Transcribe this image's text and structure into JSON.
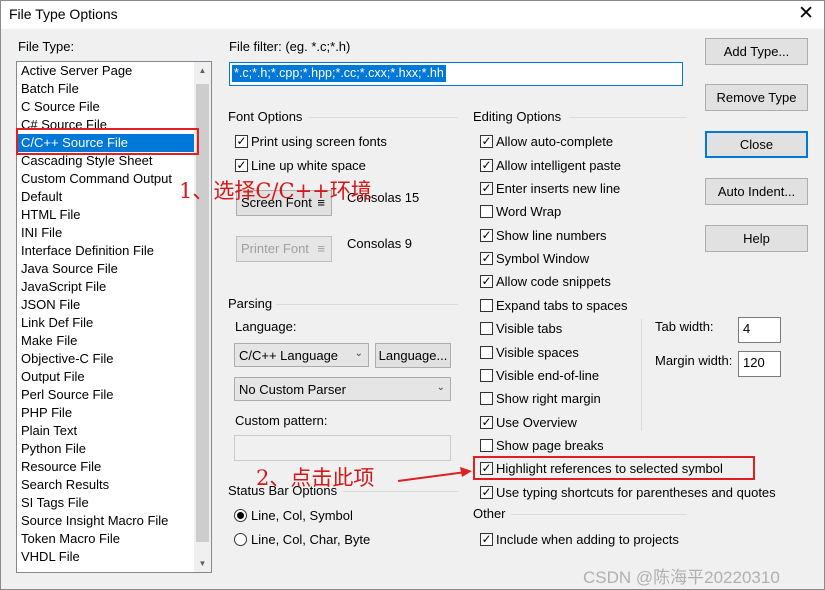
{
  "window": {
    "title": "File Type Options",
    "close_glyph": "✕"
  },
  "file_type": {
    "label": "File Type:",
    "items": [
      "Active Server Page",
      "Batch File",
      "C Source File",
      "C# Source File",
      "C/C++ Source File",
      "Cascading Style Sheet",
      "Custom Command Output",
      "Default",
      "HTML File",
      "INI File",
      "Interface Definition File",
      "Java Source File",
      "JavaScript File",
      "JSON File",
      "Link Def File",
      "Make File",
      "Objective-C File",
      "Output File",
      "Perl Source File",
      "PHP File",
      "Plain Text",
      "Python File",
      "Resource File",
      "Search Results",
      "SI Tags File",
      "Source Insight Macro File",
      "Token Macro File",
      "VHDL File"
    ],
    "selected": "C/C++ Source File"
  },
  "file_filter": {
    "label": "File filter: (eg. *.c;*.h)",
    "value": "*.c;*.h;*.cpp;*.hpp;*.cc;*.cxx;*.hxx;*.hh"
  },
  "font_options": {
    "label": "Font Options",
    "print_screen_fonts": {
      "label": "Print using screen fonts",
      "checked": true,
      "mark": "✓"
    },
    "line_up_white_space": {
      "label": "Line up white space",
      "checked": true,
      "mark": "✓"
    },
    "screen_font_button": "Screen Font",
    "screen_font_value": "Consolas 15",
    "printer_font_button": "Printer Font",
    "printer_font_value": "Consolas 9",
    "menu_glyph": "≡"
  },
  "parsing": {
    "label": "Parsing",
    "language_label": "Language:",
    "language_value": "C/C++ Language",
    "language_button": "Language...",
    "parser_value": "No Custom Parser",
    "custom_pattern_label": "Custom pattern:",
    "custom_pattern_value": "",
    "chevron": "⌄"
  },
  "status_bar": {
    "label": "Status Bar Options",
    "options": [
      {
        "label": "Line, Col, Symbol",
        "selected": true
      },
      {
        "label": "Line, Col, Char, Byte",
        "selected": false
      }
    ]
  },
  "editing": {
    "label": "Editing Options",
    "options": [
      {
        "label": "Allow auto-complete",
        "checked": true
      },
      {
        "label": "Allow intelligent paste",
        "checked": true
      },
      {
        "label": "Enter inserts new line",
        "checked": true
      },
      {
        "label": "Word Wrap",
        "checked": false
      },
      {
        "label": "Show line numbers",
        "checked": true
      },
      {
        "label": "Symbol Window",
        "checked": true
      },
      {
        "label": "Allow code snippets",
        "checked": true
      },
      {
        "label": "Expand tabs to spaces",
        "checked": false
      },
      {
        "label": "Visible tabs",
        "checked": false
      },
      {
        "label": "Visible spaces",
        "checked": false
      },
      {
        "label": "Visible end-of-line",
        "checked": false
      },
      {
        "label": "Show right margin",
        "checked": false
      },
      {
        "label": "Use Overview",
        "checked": true
      },
      {
        "label": "Show page breaks",
        "checked": false
      },
      {
        "label": "Highlight references to selected symbol",
        "checked": true
      },
      {
        "label": "Use typing shortcuts for parentheses and quotes",
        "checked": true
      }
    ],
    "tab_width_label": "Tab width:",
    "tab_width_value": "4",
    "margin_width_label": "Margin width:",
    "margin_width_value": "120"
  },
  "other": {
    "label": "Other",
    "include_when_adding": {
      "label": "Include when adding to projects",
      "checked": true
    }
  },
  "buttons": {
    "add_type": "Add Type...",
    "remove_type": "Remove Type",
    "close": "Close",
    "auto_indent": "Auto Indent...",
    "help": "Help"
  },
  "annotations": {
    "step1": "1、选择C/C++环境",
    "step2": "2、点击此项",
    "color": "#e02020"
  },
  "watermark": "CSDN @陈海平20220310",
  "scroll_arrows": {
    "up": "▲",
    "down": "▼"
  }
}
